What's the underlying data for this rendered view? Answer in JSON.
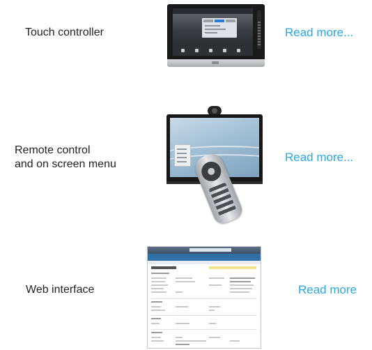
{
  "rows": [
    {
      "label": "Touch controller",
      "link": "Read more...",
      "image_icon": "touch-controller-device"
    },
    {
      "label": "Remote control\nand on screen menu",
      "link": "Read more...",
      "image_icon": "remote-control-tv-device"
    },
    {
      "label": "Web interface",
      "link": "Read more",
      "image_icon": "web-interface-screenshot"
    }
  ],
  "colors": {
    "link": "#2aa9e0",
    "text": "#222222"
  }
}
